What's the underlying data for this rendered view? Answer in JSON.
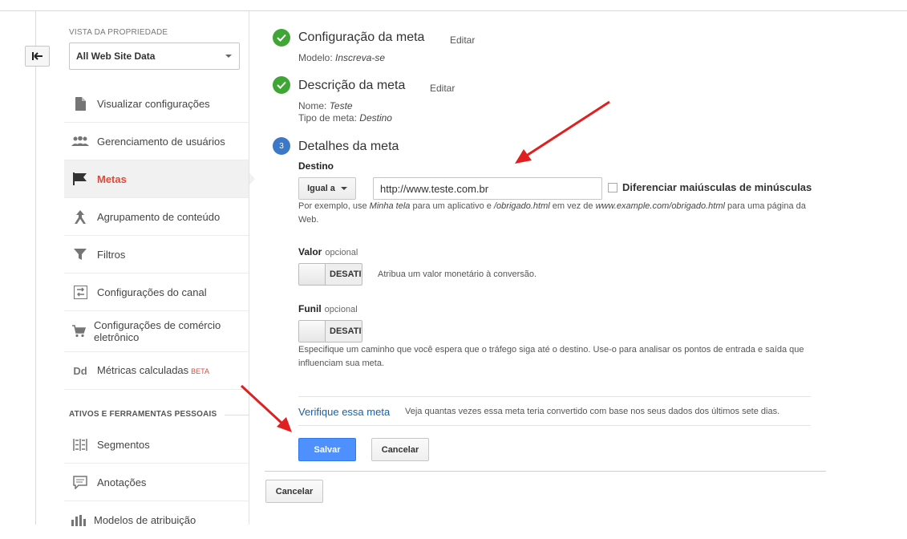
{
  "sidebar": {
    "property_label": "VISTA DA PROPRIEDADE",
    "property_select": "All Web Site Data",
    "items": [
      {
        "label": "Visualizar configurações",
        "icon": "document-icon"
      },
      {
        "label": "Gerenciamento de usuários",
        "icon": "users-icon"
      },
      {
        "label": "Metas",
        "icon": "flag-icon",
        "active": true
      },
      {
        "label": "Agrupamento de conteúdo",
        "icon": "content-grouping-icon"
      },
      {
        "label": "Filtros",
        "icon": "filter-icon"
      },
      {
        "label": "Configurações do canal",
        "icon": "channel-icon"
      },
      {
        "label": "Configurações de comércio eletrônico",
        "icon": "cart-icon"
      },
      {
        "label": "Métricas calculadas",
        "icon": "dd-icon",
        "badge": "BETA"
      }
    ],
    "section_personal": "ATIVOS E FERRAMENTAS PESSOAIS",
    "personal_items": [
      {
        "label": "Segmentos",
        "icon": "segments-icon"
      },
      {
        "label": "Anotações",
        "icon": "annotation-icon"
      },
      {
        "label": "Modelos de atribuição",
        "icon": "attribution-icon"
      }
    ]
  },
  "steps": {
    "step1": {
      "title": "Configuração da meta",
      "edit": "Editar",
      "line1_label": "Modelo:",
      "line1_value": "Inscreva-se"
    },
    "step2": {
      "title": "Descrição da meta",
      "edit": "Editar",
      "line1_label": "Nome:",
      "line1_value": "Teste",
      "line2_label": "Tipo de meta:",
      "line2_value": "Destino"
    },
    "step3": {
      "number": "3",
      "title": "Detalhes da meta"
    }
  },
  "destination": {
    "label": "Destino",
    "match_select": "Igual a",
    "url_value": "http://www.teste.com.br",
    "case_checkbox_label": "Diferenciar maiúsculas de minúsculas",
    "case_checked": false,
    "help_prefix": "Por exemplo, use ",
    "help_example1": "Minha tela",
    "help_mid1": " para um aplicativo e ",
    "help_example2": "/obrigado.html",
    "help_mid2": " em vez de ",
    "help_example3": "www.example.com/obrigado.html",
    "help_suffix": " para uma página da Web."
  },
  "value": {
    "label": "Valor",
    "optional": "opcional",
    "toggle_text": "DESATIVADO",
    "description": "Atribua um valor monetário à conversão."
  },
  "funnel": {
    "label": "Funil",
    "optional": "opcional",
    "toggle_text": "DESATIVADO",
    "help": "Especifique um caminho que você espera que o tráfego siga até o destino. Use-o para analisar os pontos de entrada e saída que influenciam sua meta."
  },
  "verify": {
    "link": "Verifique essa meta",
    "description": "Veja quantas vezes essa meta teria convertido com base nos seus dados dos últimos sete dias."
  },
  "actions": {
    "save": "Salvar",
    "cancel": "Cancelar",
    "cancel_outer": "Cancelar"
  },
  "colors": {
    "accent_red": "#dd4b39",
    "save_blue": "#4d90fe",
    "check_green": "#3fa535",
    "step_blue": "#3b79c8",
    "link_blue": "#1a5fa8",
    "annotation_arrow": "#e02020"
  }
}
